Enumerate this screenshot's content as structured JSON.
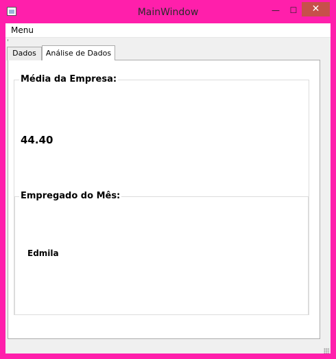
{
  "window": {
    "title": "MainWindow",
    "minimize_glyph": "—",
    "maximize_glyph": "☐",
    "close_glyph": "✕"
  },
  "menubar": {
    "items": [
      {
        "label": "Menu"
      }
    ]
  },
  "tabs": [
    {
      "label": "Dados",
      "selected": false
    },
    {
      "label": "Análise de Dados",
      "selected": true
    }
  ],
  "analysis": {
    "media_group_title": "Média da Empresa:",
    "media_value": "44.40",
    "employee_group_title": "Empregado do Mês:",
    "employee_value": "Edmila"
  },
  "colors": {
    "window_frame": "#ff1fab",
    "close_button": "#c7504b",
    "client_background": "#f0f0f0"
  }
}
